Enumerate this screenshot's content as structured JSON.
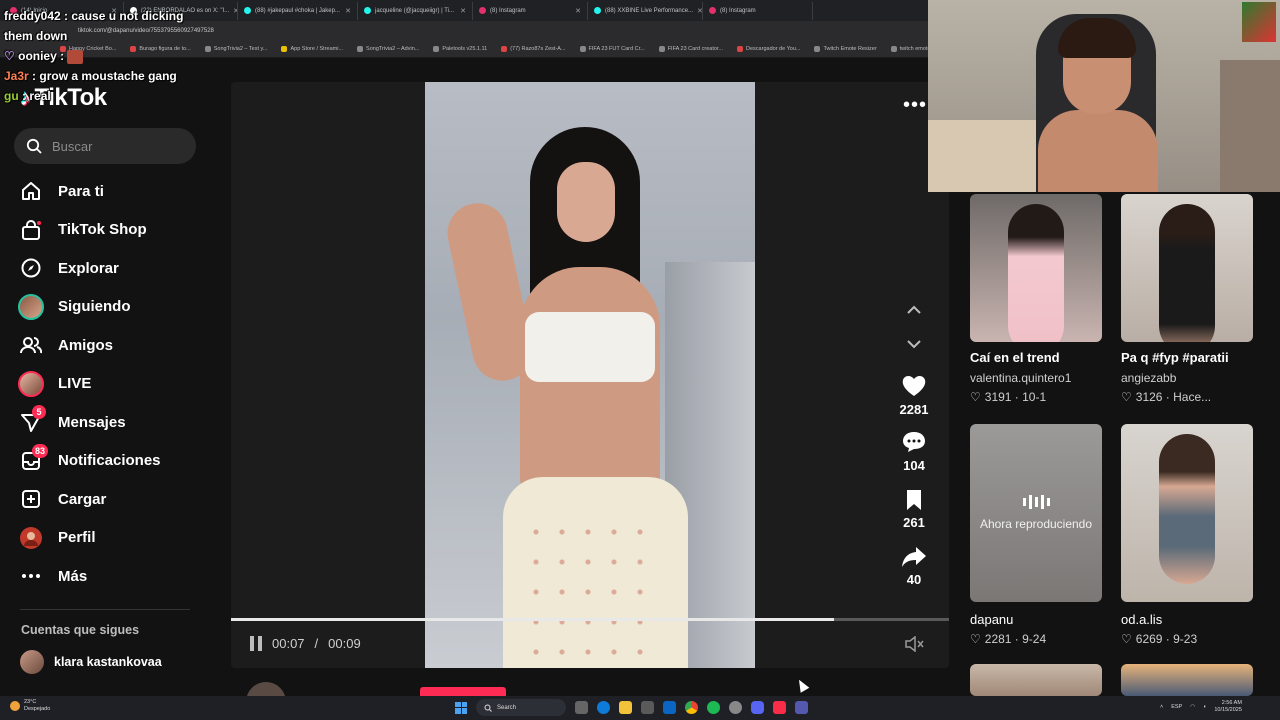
{
  "browser": {
    "tabs": [
      {
        "title": "(14) Inicio",
        "favicon_color": "#e1306c"
      },
      {
        "title": "(22) ENBORDALAO es on X: \"I...",
        "favicon_color": "#ffffff"
      },
      {
        "title": "(88) #jakepaul #choka | Jakep...",
        "favicon_color": "#25f4ee"
      },
      {
        "title": "jacqueline (@jacqueiigr) | Ti...",
        "favicon_color": "#25f4ee"
      },
      {
        "title": "(8) Instagram",
        "favicon_color": "#e1306c"
      },
      {
        "title": "(88) XXBINE Live Performance...",
        "favicon_color": "#25f4ee"
      },
      {
        "title": "(8) Instagram",
        "favicon_color": "#e1306c"
      }
    ],
    "url": "tiktok.com/@dapanu/video/7553795560927497528",
    "bookmarks": [
      "Happy Cricket Bo...",
      "Burago figura de to...",
      "SongTrivia2 – Test y...",
      "App Store / Streami...",
      "SongTrivia2 – Advin...",
      "Paletools v25.1.11",
      "(77) Razo87s Zest-A...",
      "FIFA 23 FUT Card Cr...",
      "FIFA 23 Card creator...",
      "Descargador de You...",
      "Twitch Emote Resizer",
      "twitch emote resizer"
    ]
  },
  "chat": [
    {
      "user": "freddy042",
      "message": ": cause u not dicking them down"
    },
    {
      "user": "ooniey",
      "message": ":"
    },
    {
      "user": "Ja3r",
      "message": ": grow a moustache gang"
    },
    {
      "user": "gu",
      "message": ": real"
    }
  ],
  "sidebar": {
    "logo": "TikTok",
    "search_placeholder": "Buscar",
    "items": [
      {
        "label": "Para ti",
        "icon": "home-icon"
      },
      {
        "label": "TikTok Shop",
        "icon": "shop-icon"
      },
      {
        "label": "Explorar",
        "icon": "compass-icon"
      },
      {
        "label": "Siguiendo",
        "icon": "following-avatar"
      },
      {
        "label": "Amigos",
        "icon": "friends-icon"
      },
      {
        "label": "LIVE",
        "icon": "live-avatar"
      },
      {
        "label": "Mensajes",
        "icon": "messages-icon",
        "badge": "5"
      },
      {
        "label": "Notificaciones",
        "icon": "inbox-icon",
        "badge": "83"
      },
      {
        "label": "Cargar",
        "icon": "upload-icon"
      },
      {
        "label": "Perfil",
        "icon": "profile-avatar"
      },
      {
        "label": "Más",
        "icon": "more-icon"
      }
    ],
    "following_title": "Cuentas que sigues",
    "following": [
      {
        "name": "klara kastankovaa"
      }
    ]
  },
  "player": {
    "likes": "2281",
    "comments": "104",
    "saves": "261",
    "shares": "40",
    "current_time": "00:07",
    "duration": "00:09",
    "progress": 0.84,
    "separator": "/",
    "author": "dapanu"
  },
  "recommendations": [
    {
      "title": "Caí en el trend",
      "user": "valentina.quintero1",
      "stats": "3191 · 10-1"
    },
    {
      "title": "Pa q #fyp #paratii",
      "user": "angiezabb",
      "stats": "3126 · Hace..."
    },
    {
      "title": "",
      "user": "dapanu",
      "stats": "2281 · 9-24",
      "overlay": "Ahora reproduciendo"
    },
    {
      "title": "",
      "user": "od.a.lis",
      "stats": "6269 · 9-23"
    }
  ],
  "taskbar": {
    "weather_temp": "23°C",
    "weather_desc": "Despejado",
    "search_label": "Search",
    "language": "ESP",
    "time": "2:56 AM",
    "date": "10/15/2025"
  },
  "colors": {
    "accent": "#fe2c55",
    "cyan": "#25f4ee",
    "background": "#121212"
  }
}
